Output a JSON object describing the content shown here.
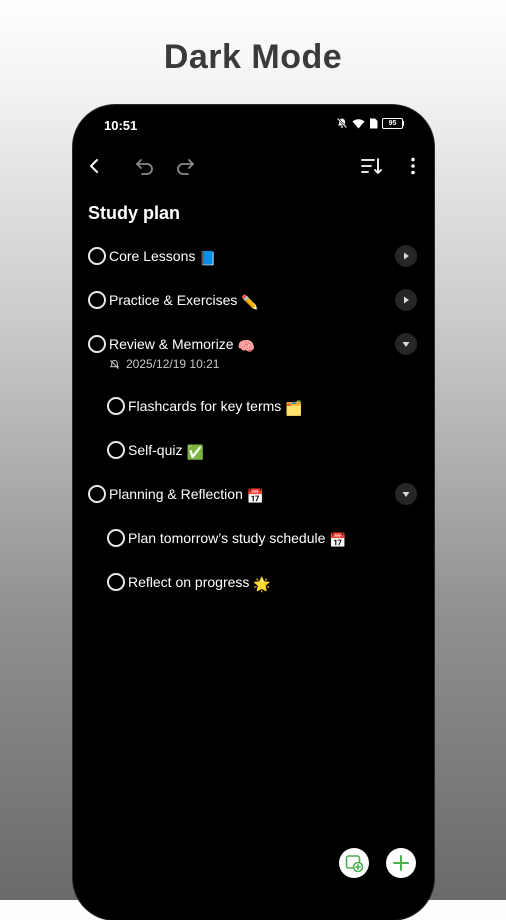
{
  "headline": "Dark Mode",
  "status_bar": {
    "time": "10:51",
    "battery": "95",
    "icons": [
      "mute-bell-icon",
      "wifi-icon",
      "sim-icon",
      "battery-icon"
    ]
  },
  "toolbar": {
    "icons": [
      "back-arrow-icon",
      "undo-icon",
      "redo-icon",
      "sort-icon",
      "more-vertical-icon"
    ]
  },
  "list_title": "Study plan",
  "tasks": [
    {
      "label": "Core Lessons",
      "emoji": "📘",
      "expand": "collapsed"
    },
    {
      "label": "Practice & Exercises",
      "emoji": "✏️",
      "expand": "collapsed"
    },
    {
      "label": "Review & Memorize",
      "emoji": "🧠",
      "expand": "expanded",
      "reminder": "2025/12/19 10:21"
    },
    {
      "label": "Flashcards for key terms",
      "emoji": "🗂️",
      "subtask": true
    },
    {
      "label": "Self-quiz",
      "emoji": "✅",
      "subtask": true
    },
    {
      "label": "Planning & Reflection",
      "emoji": "📅",
      "expand": "expanded"
    },
    {
      "label": "Plan tomorrow’s study schedule",
      "emoji": "📅",
      "subtask": true
    },
    {
      "label": "Reflect on progress",
      "emoji": "🌟",
      "subtask": true
    }
  ],
  "fabs": [
    "add-list-icon",
    "add-task-icon"
  ],
  "colors": {
    "accent": "#4caf50",
    "background": "#000000",
    "text": "#ffffff"
  }
}
